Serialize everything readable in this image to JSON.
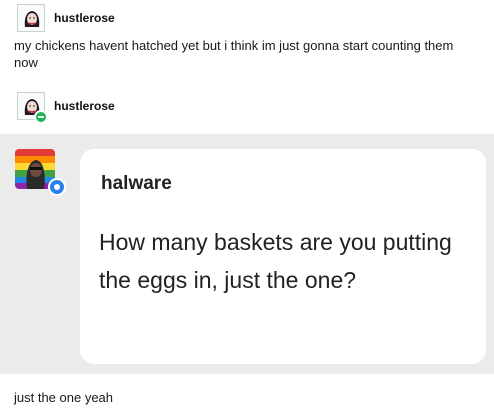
{
  "post": {
    "username": "hustlerose",
    "text": "my chickens havent hatched yet but i think im just gonna start counting them now"
  },
  "reblog": {
    "username": "hustlerose"
  },
  "quoted_post": {
    "username": "halware",
    "text": "How many baskets are you putting the eggs in, just the one?"
  },
  "reply": {
    "text": "just the one yeah"
  }
}
